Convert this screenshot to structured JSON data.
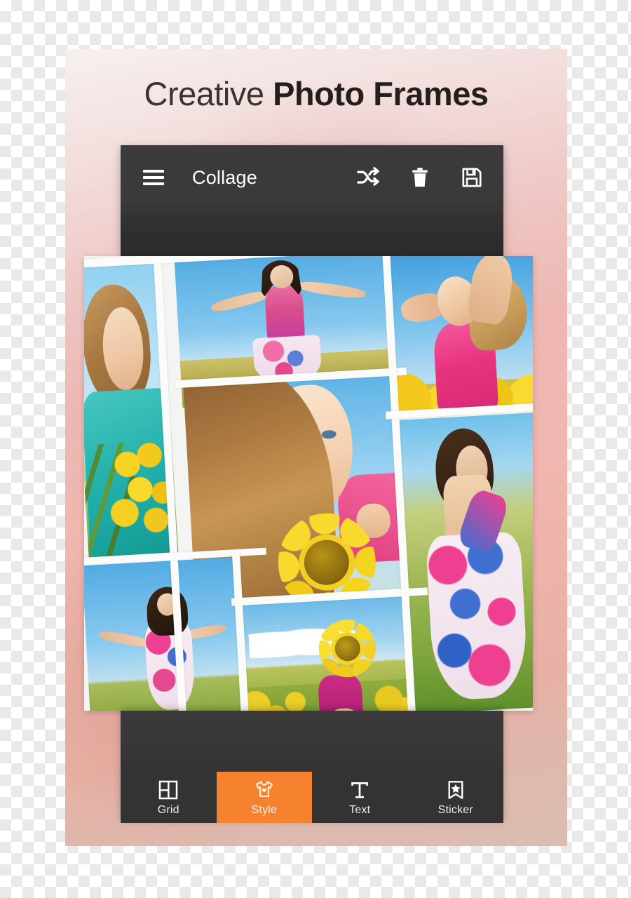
{
  "promo": {
    "headline_light": "Creative",
    "headline_bold": "Photo Frames",
    "card_bg_top": "#f7f0ef",
    "card_bg_mid": "#f0b7b0",
    "card_bg_bottom": "#dcbcb2"
  },
  "app": {
    "header": {
      "title": "Collage",
      "menu_icon": "hamburger-icon",
      "actions": [
        {
          "name": "shuffle-icon",
          "label": "Shuffle"
        },
        {
          "name": "delete-icon",
          "label": "Delete"
        },
        {
          "name": "save-icon",
          "label": "Save"
        }
      ],
      "bg_color": "#3a3a3a"
    },
    "collage": {
      "name": "photo-collage-canvas",
      "divider_color": "#fbfbf9",
      "tile_count": 7,
      "tiles": [
        {
          "id": 1,
          "alt": "Woman in teal dress holding sunflowers"
        },
        {
          "id": 2,
          "alt": "Woman with arms outstretched in wheat field"
        },
        {
          "id": 3,
          "alt": "Blonde woman in pink top stretching in sunflower field"
        },
        {
          "id": 4,
          "alt": "Close-up of smiling woman holding a sunflower"
        },
        {
          "id": 5,
          "alt": "Woman in floral dress walking through green field"
        },
        {
          "id": 6,
          "alt": "Woman in floral dress arms out under blue sky"
        },
        {
          "id": 7,
          "alt": "Sunflower covering face in sunflower field"
        }
      ]
    },
    "tabbar": {
      "active_color": "#f6812f",
      "inactive_color": "#333333",
      "tabs": [
        {
          "label": "Grid",
          "icon": "grid-icon",
          "active": false
        },
        {
          "label": "Style",
          "icon": "tshirt-icon",
          "active": true
        },
        {
          "label": "Text",
          "icon": "text-t-icon",
          "active": false
        },
        {
          "label": "Sticker",
          "icon": "bookmark-star-icon",
          "active": false
        }
      ]
    }
  }
}
